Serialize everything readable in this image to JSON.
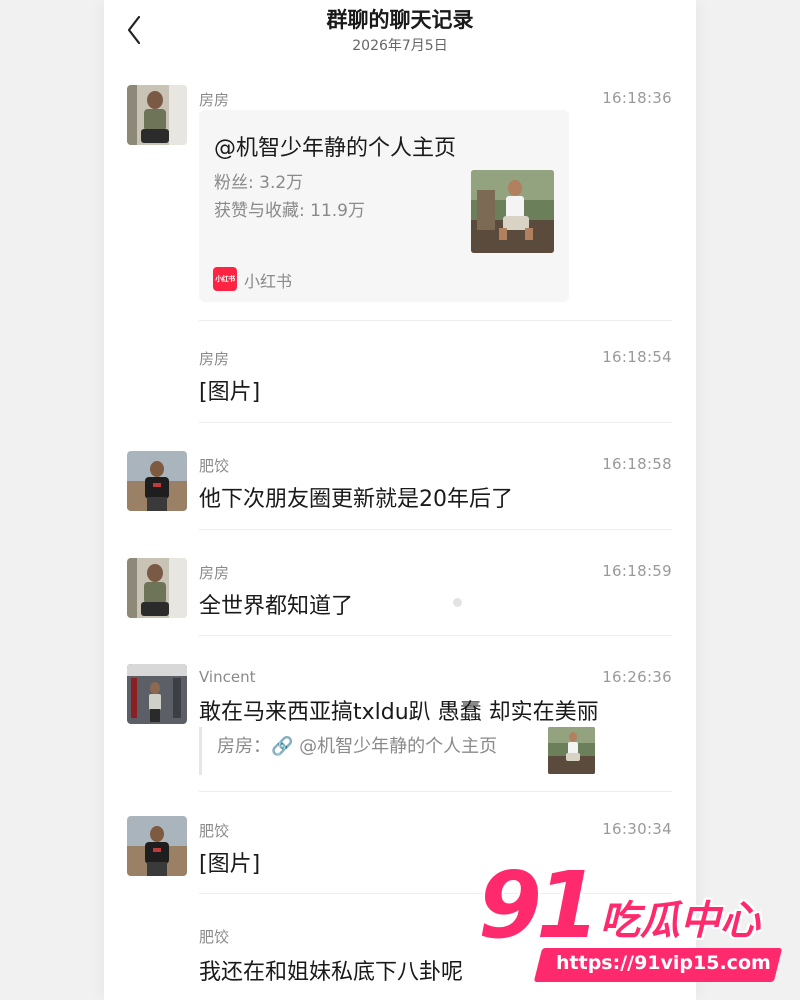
{
  "header": {
    "title": "群聊的聊天记录",
    "date": "2026年7月5日"
  },
  "messages": [
    {
      "sender": "房房",
      "time": "16:18:36",
      "card": {
        "title": "@机智少年静的个人主页",
        "fans": "粉丝: 3.2万",
        "likes": "获赞与收藏: 11.9万",
        "source_logo": "小红书",
        "source": "小红书"
      }
    },
    {
      "sender": "房房",
      "time": "16:18:54",
      "text": "[图片]"
    },
    {
      "sender": "肥饺",
      "time": "16:18:58",
      "text": "他下次朋友圈更新就是20年后了"
    },
    {
      "sender": "房房",
      "time": "16:18:59",
      "text": "全世界都知道了"
    },
    {
      "sender": "Vincent",
      "time": "16:26:36",
      "text": "敢在马来西亚搞txldu趴 愚蠢 却实在美丽",
      "quote": "房房：🔗 @机智少年静的个人主页"
    },
    {
      "sender": "肥饺",
      "time": "16:30:34",
      "text": "[图片]"
    },
    {
      "sender": "肥饺",
      "text": "我还在和姐妹私底下八卦呢"
    }
  ],
  "watermark": {
    "brand_number": "91",
    "brand_name": "吃瓜中心",
    "url": "https://91vip15.com"
  },
  "icons": {
    "back": "chevron-left-icon",
    "link": "link-icon"
  },
  "colors": {
    "accent": "#ff2442",
    "watermark": "#ff2a6d"
  }
}
